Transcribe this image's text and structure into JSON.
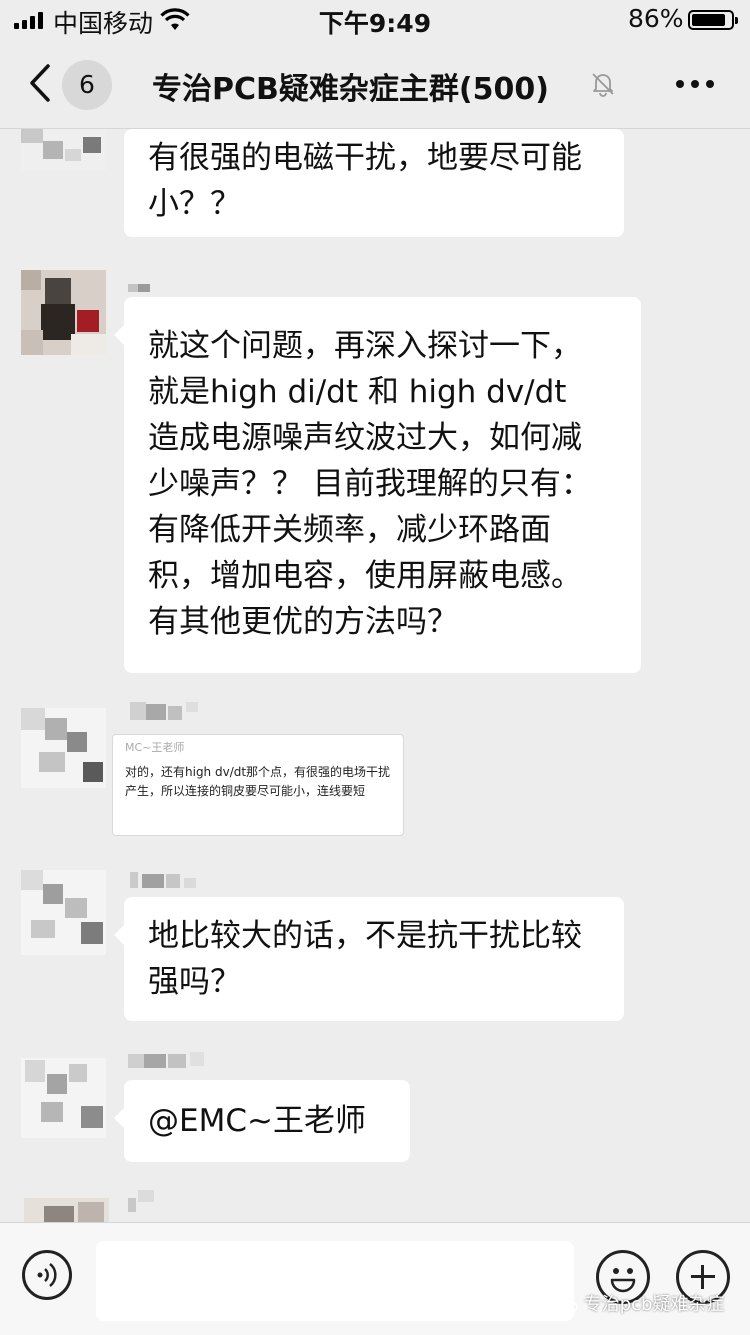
{
  "status_bar": {
    "carrier": "中国移动",
    "time": "下午9:49",
    "battery_percent": "86%",
    "battery_level": 0.86
  },
  "nav": {
    "unread_count": "6",
    "title": "专治PCB疑难杂症主群(500)"
  },
  "messages": [
    {
      "text": "有很强的电磁干扰，地要尽可能小？？"
    },
    {
      "text": "就这个问题，再深入探讨一下，就是high di/dt 和 high dv/dt 造成电源噪声纹波过大，如何减少噪声？？ 目前我理解的只有：有降低开关频率，减少环路面积，增加电容，使用屏蔽电感。有其他更优的方法吗？"
    },
    {
      "quote_head": "MC~王老师",
      "quote_text": "对的，还有high dv/dt那个点，有很强的电场干扰产生，所以连接的铜皮要尽可能小，连线要短"
    },
    {
      "text": "地比较大的话，不是抗干扰比较强吗？"
    },
    {
      "text": "@EMC~王老师"
    }
  ],
  "watermark": "专治pcb疑难杂症",
  "colors": {
    "background": "#ededed",
    "bubble": "#ffffff",
    "input_bar": "#f7f7f7"
  }
}
